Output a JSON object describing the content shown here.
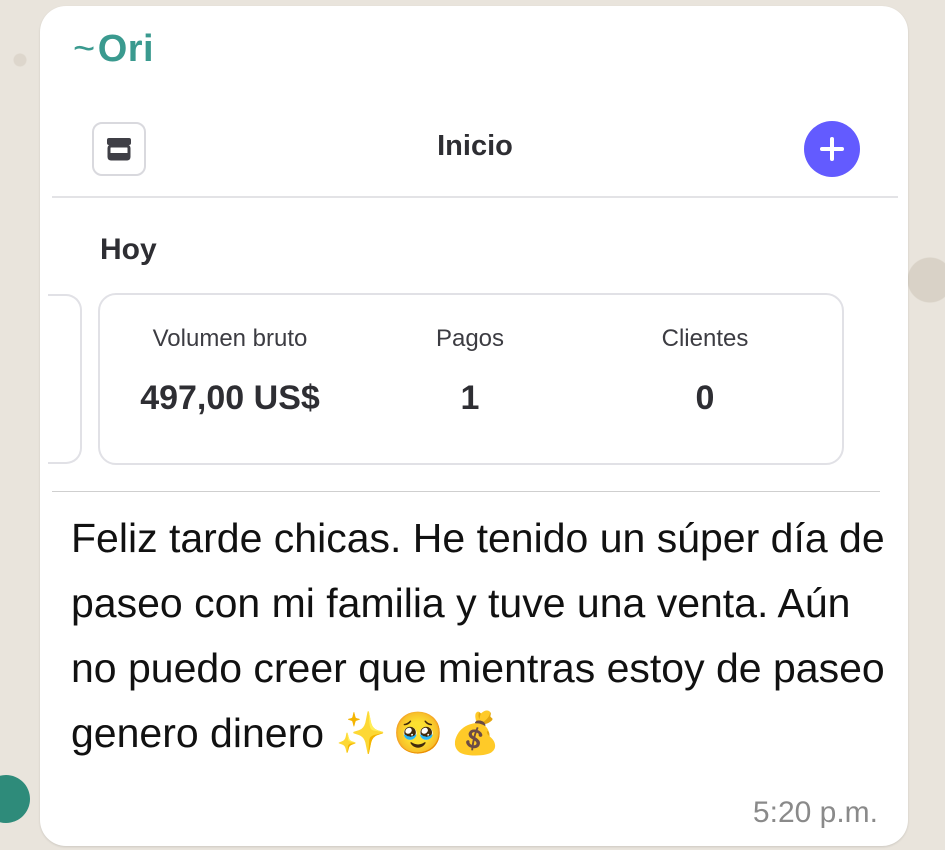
{
  "chat": {
    "sender": "Ori",
    "sender_prefix": "~",
    "timestamp": "5:20 p.m.",
    "message": "Feliz tarde chicas. He tenido un súper día de paseo con mi familia y tuve una venta. Aún no puedo creer que mientras estoy de paseo genero dinero",
    "emojis": "✨🥹💰"
  },
  "screenshot": {
    "header": {
      "title": "Inicio",
      "left_icon": "store-icon",
      "right_icon": "plus-icon"
    },
    "section_title": "Hoy",
    "stats": [
      {
        "label": "Volumen bruto",
        "value": "497,00 US$"
      },
      {
        "label": "Pagos",
        "value": "1"
      },
      {
        "label": "Clientes",
        "value": "0"
      }
    ],
    "colors": {
      "accent": "#635bff",
      "sender": "#3a9a8f"
    }
  }
}
